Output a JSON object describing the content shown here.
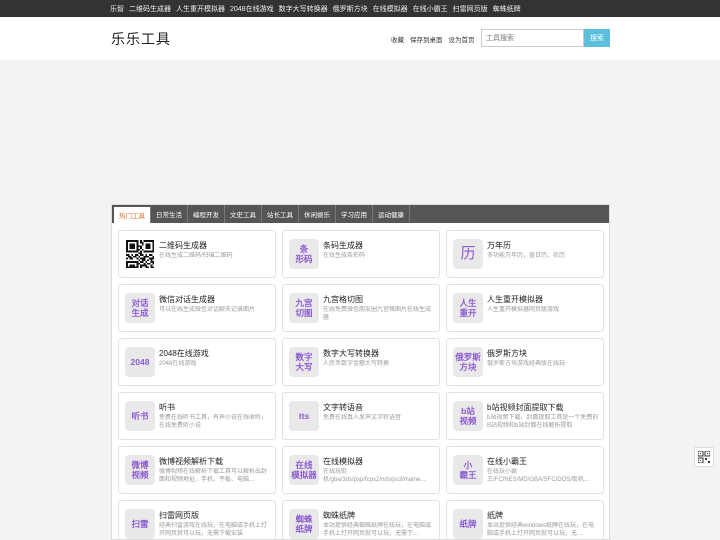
{
  "topbar": {
    "links": [
      "乐智",
      "二维码生成器",
      "人生重开模拟器",
      "2048在线游戏",
      "数字大写转换器",
      "俄罗斯方块",
      "在线模拟器",
      "在线小霸王",
      "扫雷网页版",
      "蜘蛛纸牌"
    ]
  },
  "header": {
    "logo": "乐乐工具",
    "links": [
      "收藏",
      "保存到桌面",
      "设为首页"
    ],
    "search_placeholder": "工具搜索",
    "search_button": "搜索"
  },
  "tabs": [
    "热门工具",
    "日常生活",
    "编程开发",
    "文史工具",
    "站长工具",
    "休闲娱乐",
    "学习应用",
    "运动健康"
  ],
  "active_tab": 0,
  "colors": {
    "accent": "#5bc0de",
    "icon_text": "#8c5bd1",
    "tab_active": "#e06d2c"
  },
  "tools": [
    {
      "icon": "qr-code",
      "title": "二维码生成器",
      "desc": "在线生成二维码/扫描二维码"
    },
    {
      "icon": "条\n形码",
      "title": "条码生成器",
      "desc": "在线生成条形码"
    },
    {
      "icon": "历",
      "title": "万年历",
      "desc": "多功能万年历，査日历、农历"
    },
    {
      "icon": "对话\n生成",
      "title": "微信对话生成器",
      "desc": "可以在线生成微信对话聊天记录图片"
    },
    {
      "icon": "九宫\n切图",
      "title": "九宫格切图",
      "desc": "在线免费微信朋友圈九宫格图片在线生成器"
    },
    {
      "icon": "人生\n重开",
      "title": "人生重开模拟器",
      "desc": "人生重开模拟器网页版游戏"
    },
    {
      "icon": "2048",
      "title": "2048在线游戏",
      "desc": "2048在线游戏"
    },
    {
      "icon": "数字\n大写",
      "title": "数字大写转换器",
      "desc": "人民币数字金额大写转换"
    },
    {
      "icon": "俄罗斯\n方块",
      "title": "俄罗斯方块",
      "desc": "俄罗斯方块游戏经典版在线玩"
    },
    {
      "icon": "听书",
      "title": "听书",
      "desc": "免费在线听书工具，有声小说在线收听，在线免费听小说"
    },
    {
      "icon": "tts",
      "title": "文字转语音",
      "desc": "免费在线真人发声文字转语音"
    },
    {
      "icon": "b站\n视频",
      "title": "b站视频封面提取下载",
      "desc": "b站视频下载、封面提取工具是一个免费的B站视频和b站封面在线解析提取"
    },
    {
      "icon": "微博\n视频",
      "title": "微博视频解析下载",
      "desc": "微博视频在线解析下载工具可以解析出封面和视频地址，手机、平板、电脑..."
    },
    {
      "icon": "在线\n模拟器",
      "title": "在线模拟器",
      "desc": "在线玩街机/gba/3ds/psp/fcps2/nds/ps3/mame..."
    },
    {
      "icon": "小\n霸王",
      "title": "在线小霸王",
      "desc": "在线玩小霸王/FC/NES/MD/GBA/SFC/DOS/街机..."
    },
    {
      "icon": "扫雷",
      "title": "扫雷网页版",
      "desc": "经典扫雷游戏在线玩，在电脑或手机上打开网页就可以玩，无需下载安装"
    },
    {
      "icon": "蜘蛛\n纸牌",
      "title": "蜘蛛纸牌",
      "desc": "本站提供经典蜘蛛纸牌在线玩，在电脑或手机上打开网页就可以玩，无需下..."
    },
    {
      "icon": "纸牌",
      "title": "纸牌",
      "desc": "本站提供经典windows纸牌在线玩，在电脑或手机上打开网页就可以玩，无..."
    }
  ],
  "side_widget": "qr-code-icon"
}
